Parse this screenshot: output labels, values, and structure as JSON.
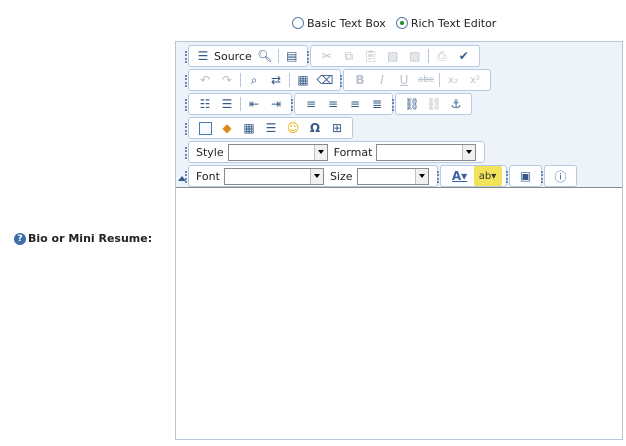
{
  "editor_mode": {
    "options": [
      {
        "label": "Basic Text Box",
        "selected": false
      },
      {
        "label": "Rich Text Editor",
        "selected": true
      }
    ]
  },
  "field": {
    "label": "Bio or Mini Resume:",
    "help_icon": "help-icon"
  },
  "toolbar": {
    "source_label": "Source",
    "style_label": "Style",
    "format_label": "Format",
    "font_label": "Font",
    "size_label": "Size",
    "style_value": "",
    "format_value": "",
    "font_value": "",
    "size_value": ""
  },
  "content": {
    "text": ""
  }
}
